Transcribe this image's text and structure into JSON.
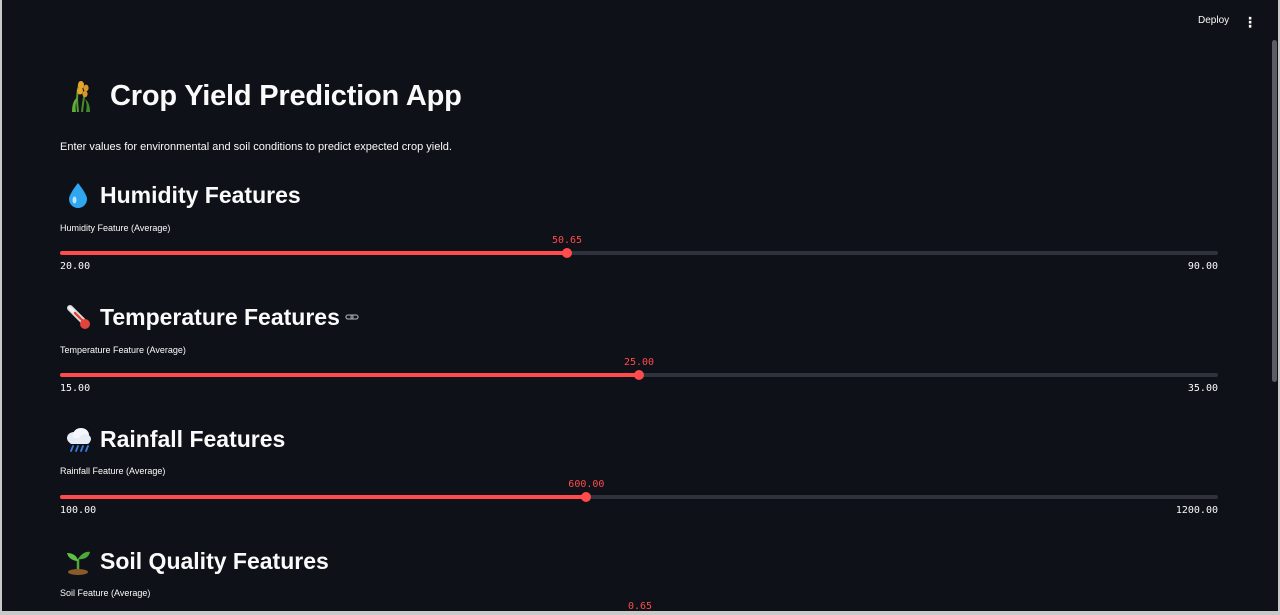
{
  "topbar": {
    "deploy_label": "Deploy",
    "menu_icon": "more-vertical-icon"
  },
  "header": {
    "icon": "crop-icon",
    "title": "Crop Yield Prediction App",
    "intro": "Enter values for environmental and soil conditions to predict expected crop yield."
  },
  "sections": [
    {
      "icon": "droplet-icon",
      "title": "Humidity Features",
      "slider": {
        "label": "Humidity Feature (Average)",
        "value": 50.65,
        "value_text": "50.65",
        "min": 20.0,
        "max": 90.0,
        "min_text": "20.00",
        "max_text": "90.00"
      }
    },
    {
      "icon": "thermometer-icon",
      "title": "Temperature Features",
      "anchor_icon": "link-icon",
      "slider": {
        "label": "Temperature Feature (Average)",
        "value": 25.0,
        "value_text": "25.00",
        "min": 15.0,
        "max": 35.0,
        "min_text": "15.00",
        "max_text": "35.00"
      }
    },
    {
      "icon": "rain-cloud-icon",
      "title": "Rainfall Features",
      "slider": {
        "label": "Rainfall Feature (Average)",
        "value": 600.0,
        "value_text": "600.00",
        "min": 100.0,
        "max": 1200.0,
        "min_text": "100.00",
        "max_text": "1200.00"
      }
    },
    {
      "icon": "seedling-icon",
      "title": "Soil Quality Features",
      "slider": {
        "label": "Soil Feature (Average)",
        "value_text": "0.65"
      }
    }
  ],
  "colors": {
    "background": "#0e1117",
    "accent": "#ff4b4b",
    "track": "#2f323a",
    "text": "#fafafa"
  }
}
